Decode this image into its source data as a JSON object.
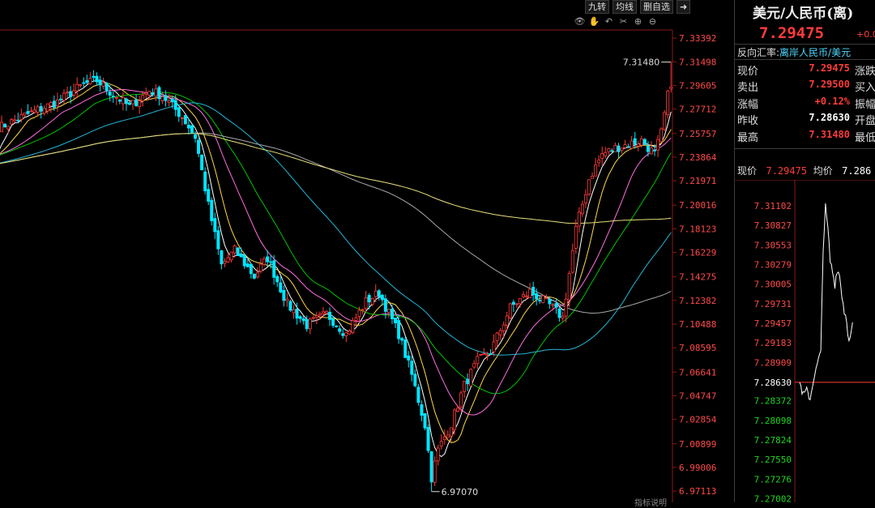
{
  "toolbar": {
    "btn_jiuzhuan": "九转",
    "btn_junxian": "均线",
    "btn_shanzixuan": "删自选"
  },
  "icons": [
    "eye-icon",
    "hand-icon",
    "undo-icon",
    "scissors-icon",
    "zoom-in-icon",
    "zoom-out-icon"
  ],
  "bottom_cut_text": "指标说明",
  "colors": {
    "up": "#ff3b3b",
    "down": "#00e5ff",
    "ma5": "#ffffff",
    "ma10": "#ffd84a",
    "ma20": "#ff6fe0",
    "ma30": "#00c400",
    "ma60": "#22b8d8",
    "ma120": "#a8a8a8",
    "ma250": "#e8e07a"
  },
  "side": {
    "pair_name": "美元/人民币(离)",
    "price": "7.29475",
    "change_small": "+0.0",
    "reverse_label": "反向汇率:",
    "reverse_link": "离岸人民币/美元",
    "quotes": [
      {
        "left": "现价",
        "value": "7.29475",
        "right": "涨跌",
        "white": false
      },
      {
        "left": "卖出",
        "value": "7.29500",
        "right": "买入",
        "white": false
      },
      {
        "left": "涨幅",
        "value": "+0.12%",
        "right": "振幅",
        "white": false
      },
      {
        "left": "昨收",
        "value": "7.28630",
        "right": "开盘",
        "white": true
      },
      {
        "left": "最高",
        "value": "7.31480",
        "right": "最低",
        "white": false
      }
    ],
    "rt_label_price": "现价",
    "rt_price": "7.29475",
    "rt_label_avg": "均价",
    "rt_avg": "7.286"
  },
  "chart_data": [
    {
      "type": "candlestick",
      "title": "",
      "ylim": [
        6.9621,
        7.3405
      ],
      "y_ticks": [
        "7.33392",
        "7.31498",
        "7.29605",
        "7.27712",
        "7.25757",
        "7.23864",
        "7.21971",
        "7.20016",
        "7.18123",
        "7.16229",
        "7.14275",
        "7.12382",
        "7.10488",
        "7.08595",
        "7.06641",
        "7.04747",
        "7.02854",
        "7.00899",
        "6.99006",
        "6.97113"
      ],
      "annotations": [
        {
          "text": "7.31480",
          "value": 7.3148
        },
        {
          "text": "6.97070",
          "value": 6.9707
        }
      ],
      "grid": false,
      "anchors": [
        [
          0,
          7.262
        ],
        [
          8,
          7.272
        ],
        [
          18,
          7.283
        ],
        [
          26,
          7.297
        ],
        [
          30,
          7.3
        ],
        [
          34,
          7.291
        ],
        [
          40,
          7.279
        ],
        [
          46,
          7.292
        ],
        [
          50,
          7.288
        ],
        [
          56,
          7.271
        ],
        [
          60,
          7.255
        ],
        [
          64,
          7.2
        ],
        [
          68,
          7.152
        ],
        [
          72,
          7.164
        ],
        [
          78,
          7.143
        ],
        [
          82,
          7.158
        ],
        [
          88,
          7.121
        ],
        [
          94,
          7.104
        ],
        [
          100,
          7.113
        ],
        [
          106,
          7.097
        ],
        [
          112,
          7.123
        ],
        [
          116,
          7.13
        ],
        [
          122,
          7.097
        ],
        [
          126,
          7.064
        ],
        [
          130,
          7.024
        ],
        [
          132,
          6.982
        ],
        [
          134,
          7.004
        ],
        [
          138,
          7.025
        ],
        [
          142,
          7.056
        ],
        [
          146,
          7.075
        ],
        [
          150,
          7.083
        ],
        [
          156,
          7.118
        ],
        [
          162,
          7.131
        ],
        [
          168,
          7.12
        ],
        [
          172,
          7.11
        ],
        [
          176,
          7.181
        ],
        [
          180,
          7.221
        ],
        [
          184,
          7.241
        ],
        [
          188,
          7.246
        ],
        [
          192,
          7.249
        ],
        [
          196,
          7.252
        ],
        [
          200,
          7.241
        ],
        [
          202,
          7.258
        ],
        [
          204,
          7.288
        ],
        [
          205,
          7.29475
        ]
      ],
      "ma_series": [
        {
          "key": "ma5",
          "period": 5
        },
        {
          "key": "ma10",
          "period": 10
        },
        {
          "key": "ma20",
          "period": 20
        },
        {
          "key": "ma30",
          "period": 30
        },
        {
          "key": "ma60",
          "period": 60
        },
        {
          "key": "ma120",
          "period": 120
        },
        {
          "key": "ma250",
          "period": 250
        }
      ]
    },
    {
      "type": "line",
      "title": "",
      "ylim": [
        7.2695,
        7.3126
      ],
      "y_ticks": [
        "7.31102",
        "7.30827",
        "7.30553",
        "7.30279",
        "7.30005",
        "7.29731",
        "7.29457",
        "7.29183",
        "7.28909",
        "7.28630",
        "7.28372",
        "7.28098",
        "7.27824",
        "7.27550",
        "7.27276",
        "7.27002"
      ],
      "prev_close": 7.2863,
      "anchors": [
        [
          0,
          7.2863
        ],
        [
          3,
          7.2845
        ],
        [
          6,
          7.2851
        ],
        [
          9,
          7.284
        ],
        [
          12,
          7.287
        ],
        [
          14,
          7.288
        ],
        [
          16,
          7.2895
        ],
        [
          18,
          7.2903
        ],
        [
          20,
          7.3052
        ],
        [
          22,
          7.3108
        ],
        [
          24,
          7.3078
        ],
        [
          26,
          7.3032
        ],
        [
          28,
          7.3018
        ],
        [
          30,
          7.3
        ],
        [
          32,
          7.3022
        ],
        [
          34,
          7.3012
        ],
        [
          36,
          7.2985
        ],
        [
          38,
          7.2962
        ],
        [
          40,
          7.2952
        ],
        [
          42,
          7.2918
        ],
        [
          44,
          7.2932
        ],
        [
          45,
          7.2947
        ]
      ]
    }
  ]
}
